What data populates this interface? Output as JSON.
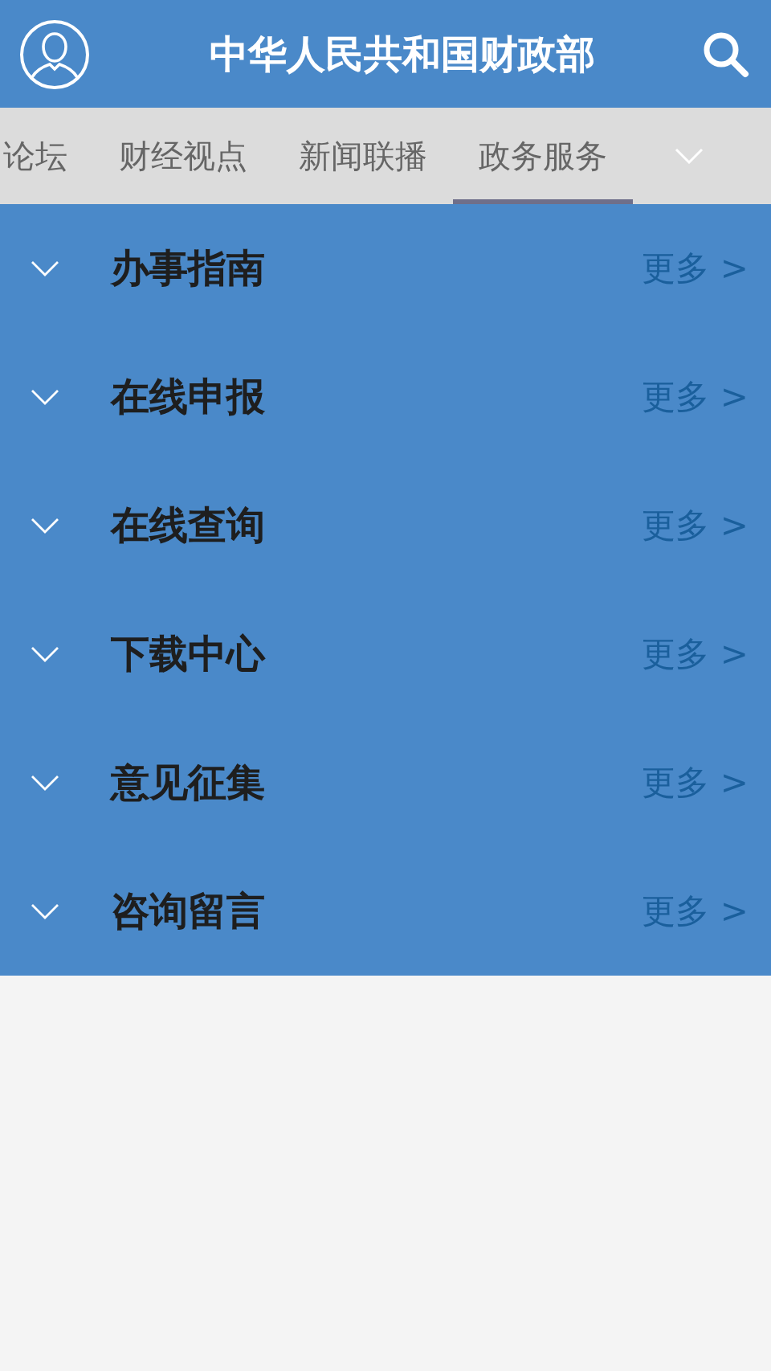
{
  "header": {
    "title": "中华人民共和国财政部"
  },
  "tabs": [
    {
      "label": "论坛",
      "selected": false
    },
    {
      "label": "财经视点",
      "selected": false
    },
    {
      "label": "新闻联播",
      "selected": false
    },
    {
      "label": "政务服务",
      "selected": true
    }
  ],
  "sections": [
    {
      "title": "办事指南",
      "expanded": false,
      "more": "更多 >"
    },
    {
      "title": "在线申报",
      "expanded": false,
      "more": "更多 >"
    },
    {
      "title": "在线查询",
      "expanded": false,
      "more": "更多 >"
    },
    {
      "title": "下载中心",
      "expanded": false,
      "more": "更多 >"
    },
    {
      "title": "意见征集",
      "expanded": false,
      "more": "更多 >"
    },
    {
      "title": "咨询留言",
      "expanded": false,
      "more": "更多 >"
    }
  ]
}
